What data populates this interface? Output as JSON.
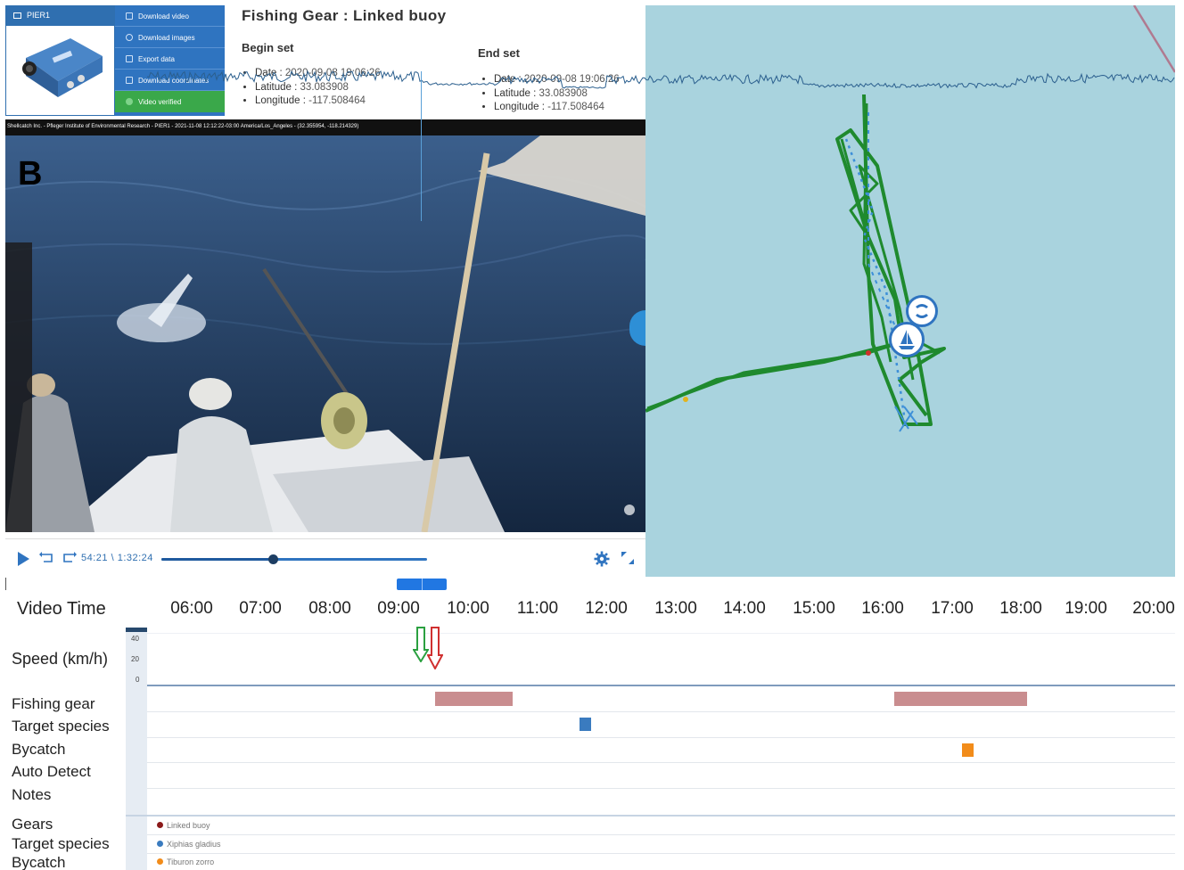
{
  "device": {
    "name": "PIER1"
  },
  "actions": [
    {
      "label": "Download video"
    },
    {
      "label": "Download images"
    },
    {
      "label": "Export data"
    },
    {
      "label": "Download coordinates"
    },
    {
      "label": "Video verified"
    }
  ],
  "gear_title": "Fishing Gear : Linked buoy",
  "begin_set": {
    "title": "Begin set",
    "date_label": "Date :",
    "date": "2020-09-08 19:06:26",
    "lat_label": "Latitude :",
    "lat": "33.083908",
    "lon_label": "Longitude :",
    "lon": "-117.508464"
  },
  "end_set": {
    "title": "End set",
    "date_label": "Date :",
    "date": "2020-09-08 19:06:26",
    "lat_label": "Latitude :",
    "lat": "33.083908",
    "lon_label": "Longitude :",
    "lon": "-117.508464"
  },
  "video": {
    "overlay_text": "Shellcatch Inc. - Pfleger Institute of Environmental Research - PIER1 - 2021-11-08 12:12:22-03:00 America/Los_Angeles - (32.355954, -118.214329)",
    "panel_label": "B",
    "time_display": "54:21 \\ 1:32:24",
    "progress": 0.42
  },
  "timeline": {
    "title": "Video Time",
    "hours": [
      "06:00",
      "07:00",
      "08:00",
      "09:00",
      "10:00",
      "11:00",
      "12:00",
      "13:00",
      "14:00",
      "15:00",
      "16:00",
      "17:00",
      "18:00",
      "19:00",
      "20:00"
    ],
    "rows": {
      "speed": "Speed (km/h)",
      "fishing_gear": "Fishing gear",
      "target_species": "Target species",
      "bycatch": "Bycatch",
      "auto_detect": "Auto Detect",
      "notes": "Notes",
      "gears": "Gears",
      "target_species_2": "Target species",
      "bycatch_2": "Bycatch"
    },
    "speed_ticks": [
      "40",
      "20",
      "0"
    ],
    "legend": [
      {
        "label": "Linked buoy",
        "color": "#8b1a1a"
      },
      {
        "label": "Xiphias gladius",
        "color": "#3a7bbf"
      },
      {
        "label": "Tiburon zorro",
        "color": "#f28c1a"
      }
    ]
  }
}
